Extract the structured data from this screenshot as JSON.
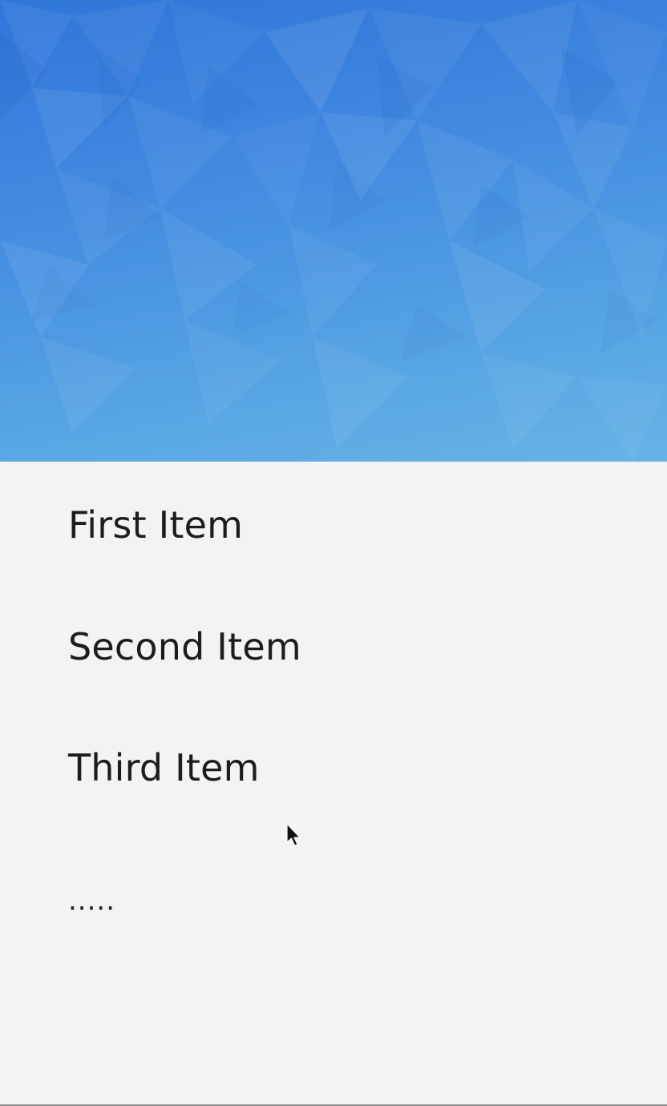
{
  "header": {
    "image": "blue-low-poly-background"
  },
  "menu": {
    "items": [
      {
        "label": "First Item"
      },
      {
        "label": "Second Item"
      },
      {
        "label": "Third Item"
      }
    ],
    "more": "....."
  },
  "colors": {
    "header_top": "#2f76d9",
    "header_bottom": "#67b3e6",
    "list_background": "#f3f3f4",
    "text": "#1c1c1c"
  }
}
